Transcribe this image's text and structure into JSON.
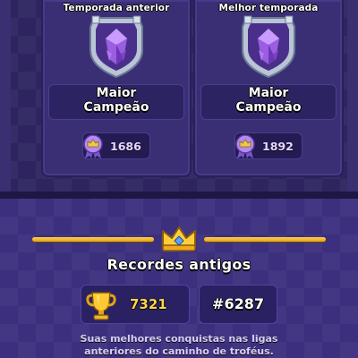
{
  "seasons": [
    {
      "title": "Temporada anterior",
      "league_name_line1": "Maior",
      "league_name_line2": "Campeão",
      "trophies": "1686",
      "league_icon": "ultimate-champion-shield-icon",
      "medal_icon": "crown-medal-icon"
    },
    {
      "title": "Melhor temporada",
      "league_name_line1": "Maior",
      "league_name_line2": "Campeão",
      "trophies": "1892",
      "league_icon": "ultimate-champion-shield-icon",
      "medal_icon": "crown-medal-icon"
    }
  ],
  "old_records": {
    "title": "Recordes antigos",
    "trophies": "7321",
    "rank": "#6287",
    "description_line1": "Suas melhores conquistas nas ligas",
    "description_line2": "anteriores do caminho de troféus.",
    "crown_icon": "gold-crown-icon",
    "trophy_icon": "gold-trophy-icon"
  },
  "colors": {
    "panel": "#3a2f75",
    "gold": "#ffd64a",
    "medal_purple": "#a77be6"
  }
}
